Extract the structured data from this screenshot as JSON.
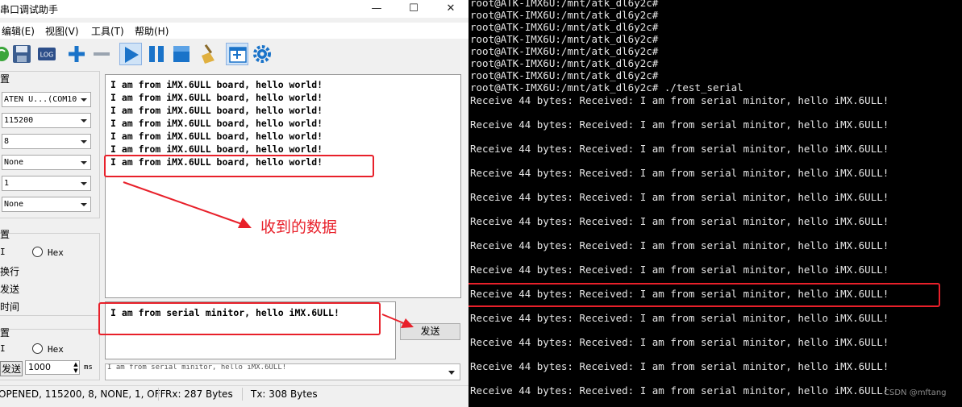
{
  "window": {
    "title": "串口调试助手",
    "min_glyph": "—",
    "max_glyph": "☐",
    "close_glyph": "✕"
  },
  "menu": [
    "编辑(E)",
    "视图(V)",
    "工具(T)",
    "帮助(H)"
  ],
  "toolbar_icons": [
    "refresh-icon",
    "save-icon",
    "log-icon",
    "add-icon",
    "remove-icon",
    "play-icon",
    "pause-icon",
    "stop-icon",
    "clear-broom-icon",
    "new-window-icon",
    "settings-gear-icon"
  ],
  "toolbar": {
    "log_label": "LOG"
  },
  "serial_settings": {
    "title": "置",
    "port": "ATEN U...(COM10",
    "baud": "115200",
    "data_bits": "8",
    "parity": "None",
    "stop_bits": "1",
    "flow": "None"
  },
  "recv_settings": {
    "title": "置",
    "ascii_label": "I",
    "hex_label": "Hex",
    "opt1": "换行",
    "opt2": "发送",
    "opt3": "时间"
  },
  "send_settings": {
    "title": "置",
    "ascii_label": "I",
    "hex_label": "Hex",
    "timed_send_label": "发送",
    "interval": "1000",
    "unit": "ms"
  },
  "receive": {
    "lines": [
      "I am from iMX.6ULL board, hello world!",
      "I am from iMX.6ULL board, hello world!",
      "I am from iMX.6ULL board, hello world!",
      "I am from iMX.6ULL board, hello world!",
      "I am from iMX.6ULL board, hello world!",
      "I am from iMX.6ULL board, hello world!",
      "I am from iMX.6ULL board, hello world!"
    ]
  },
  "send": {
    "text": "I am from serial minitor, hello iMX.6ULL!",
    "button": "发送",
    "history": "I am from serial minitor, hello iMX.6ULL!"
  },
  "annotation": "收到的数据",
  "status": {
    "port_state": "OPENED, 115200, 8, NONE, 1, OFF",
    "rx": "Rx: 287 Bytes",
    "tx": "Tx: 308 Bytes"
  },
  "terminal": {
    "prompt_lines": [
      "root@ATK-IMX6U:/mnt/atk_dl6y2c#",
      "root@ATK-IMX6U:/mnt/atk_dl6y2c#",
      "root@ATK-IMX6U:/mnt/atk_dl6y2c#",
      "root@ATK-IMX6U:/mnt/atk_dl6y2c#",
      "root@ATK-IMX6U:/mnt/atk_dl6y2c#",
      "root@ATK-IMX6U:/mnt/atk_dl6y2c#",
      "root@ATK-IMX6U:/mnt/atk_dl6y2c#",
      "root@ATK-IMX6U:/mnt/atk_dl6y2c# ./test_serial"
    ],
    "receive_lines": [
      "Receive 44 bytes: Received: I am from serial minitor, hello iMX.6ULL!",
      "Receive 44 bytes: Received: I am from serial minitor, hello iMX.6ULL!",
      "Receive 44 bytes: Received: I am from serial minitor, hello iMX.6ULL!",
      "Receive 44 bytes: Received: I am from serial minitor, hello iMX.6ULL!",
      "Receive 44 bytes: Received: I am from serial minitor, hello iMX.6ULL!",
      "Receive 44 bytes: Received: I am from serial minitor, hello iMX.6ULL!",
      "Receive 44 bytes: Received: I am from serial minitor, hello iMX.6ULL!",
      "Receive 44 bytes: Received: I am from serial minitor, hello iMX.6ULL!",
      "Receive 44 bytes: Received: I am from serial minitor, hello iMX.6ULL!",
      "Receive 44 bytes: Received: I am from serial minitor, hello iMX.6ULL!",
      "Receive 44 bytes: Received: I am from serial minitor, hello iMX.6ULL!",
      "Receive 44 bytes: Received: I am from serial minitor, hello iMX.6ULL!",
      "Receive 44 bytes: Received: I am from serial minitor, hello iMX.6ULL!"
    ],
    "watermark": "CSDN @mftang"
  },
  "colors": {
    "highlight": "#e8202a",
    "terminal_bg": "#000000",
    "terminal_fg": "#e6e6e6",
    "toolbar_blue": "#1a73c9"
  }
}
